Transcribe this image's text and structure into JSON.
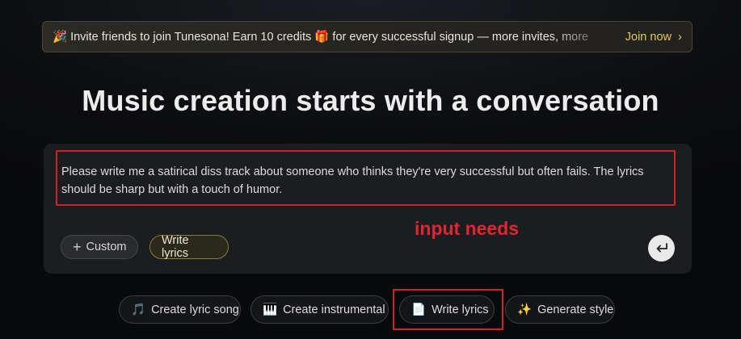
{
  "banner": {
    "emoji_left": "🎉",
    "text_before_gift": "Invite friends to join Tunesona! Earn 10 credits ",
    "gift_emoji": "🎁",
    "text_after_gift": " for every successful signup — more invites, more",
    "join_label": "Join now",
    "join_chevron": "›"
  },
  "page": {
    "title": "Music creation starts with a conversation"
  },
  "composer": {
    "prompt_value": "Please write me a satirical diss track about someone who thinks they're very successful but often fails. The lyrics should be sharp but with a touch of humor.",
    "chip_custom_plus": "+",
    "chip_custom_label": "Custom",
    "chip_write_label": "Write lyrics",
    "send_icon": "enter-return-icon"
  },
  "annotation": {
    "text": "input needs",
    "color": "#e0262f"
  },
  "quick_actions": [
    {
      "icon": "music-note-icon",
      "glyph": "🎵",
      "label": "Create lyric song"
    },
    {
      "icon": "piano-icon",
      "glyph": "🎹",
      "label": "Create instrumental"
    },
    {
      "icon": "document-icon",
      "glyph": "📄",
      "label": "Write lyrics"
    },
    {
      "icon": "sparkles-icon",
      "glyph": "✨",
      "label": "Generate style"
    }
  ],
  "colors": {
    "accent_gold": "#e8c55c",
    "highlight_red": "#d4202a"
  }
}
